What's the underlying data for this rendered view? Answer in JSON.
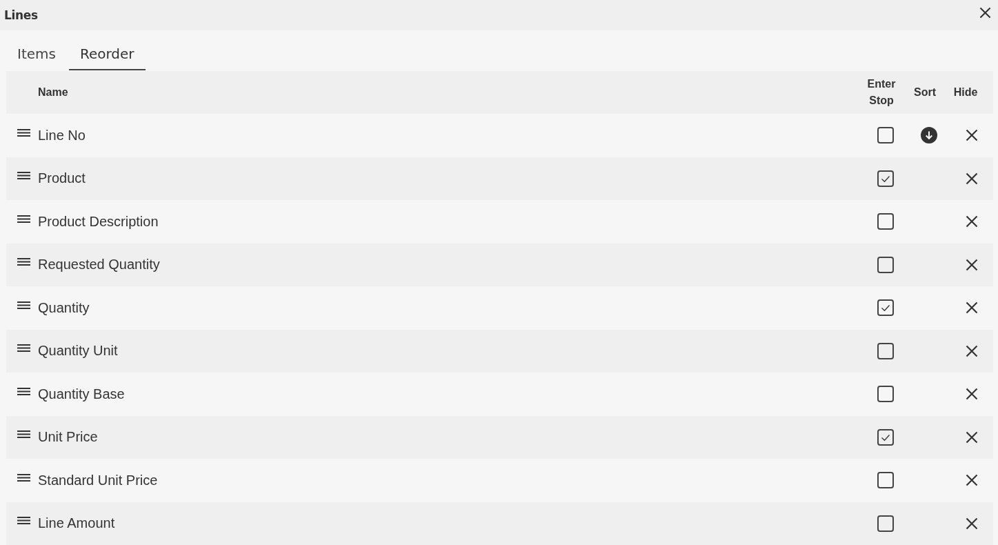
{
  "window": {
    "title": "Lines"
  },
  "tabs": [
    {
      "label": "Items",
      "selected": false
    },
    {
      "label": "Reorder",
      "selected": true
    }
  ],
  "table": {
    "columns": [
      "Name",
      "Enter Stop",
      "Sort",
      "Hide"
    ],
    "rows": [
      {
        "name": "Line No",
        "enter_stop": false,
        "sorted": true
      },
      {
        "name": "Product",
        "enter_stop": true,
        "sorted": false
      },
      {
        "name": "Product Description",
        "enter_stop": false,
        "sorted": false
      },
      {
        "name": "Requested Quantity",
        "enter_stop": false,
        "sorted": false
      },
      {
        "name": "Quantity",
        "enter_stop": true,
        "sorted": false
      },
      {
        "name": "Quantity Unit",
        "enter_stop": false,
        "sorted": false
      },
      {
        "name": "Quantity Base",
        "enter_stop": false,
        "sorted": false
      },
      {
        "name": "Unit Price",
        "enter_stop": true,
        "sorted": false
      },
      {
        "name": "Standard Unit Price",
        "enter_stop": false,
        "sorted": false
      },
      {
        "name": "Line Amount",
        "enter_stop": false,
        "sorted": false
      }
    ]
  }
}
